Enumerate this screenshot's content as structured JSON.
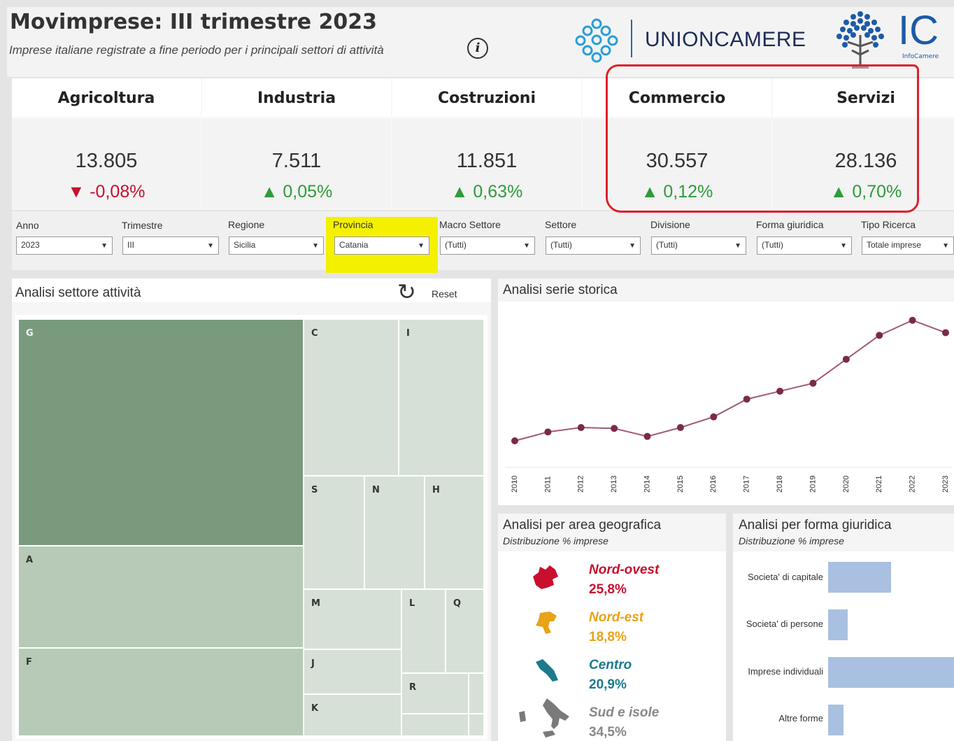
{
  "header": {
    "title": "Movimprese: III trimestre 2023",
    "subtitle": "Imprese italiane registrate a fine periodo per i principali settori di attività",
    "info_icon": "i",
    "logo_unioncamere": "UNIONCAMERE",
    "logo_ic": "IC",
    "logo_ic_sub": "InfoCamere"
  },
  "kpis": [
    {
      "name": "Agricoltura",
      "value": "13.805",
      "arrow": "▼",
      "delta": "-0,08%",
      "trend": "down"
    },
    {
      "name": "Industria",
      "value": "7.511",
      "arrow": "▲",
      "delta": "0,05%",
      "trend": "up"
    },
    {
      "name": "Costruzioni",
      "value": "11.851",
      "arrow": "▲",
      "delta": "0,63%",
      "trend": "up"
    },
    {
      "name": "Commercio",
      "value": "30.557",
      "arrow": "▲",
      "delta": "0,12%",
      "trend": "up"
    },
    {
      "name": "Servizi",
      "value": "28.136",
      "arrow": "▲",
      "delta": "0,70%",
      "trend": "up"
    }
  ],
  "filters": [
    {
      "label": "Anno",
      "value": "2023"
    },
    {
      "label": "Trimestre",
      "value": "III"
    },
    {
      "label": "Regione",
      "value": "Sicilia"
    },
    {
      "label": "Provincia",
      "value": "Catania"
    },
    {
      "label": "Macro Settore",
      "value": "(Tutti)"
    },
    {
      "label": "Settore",
      "value": "(Tutti)"
    },
    {
      "label": "Divisione",
      "value": "(Tutti)"
    },
    {
      "label": "Forma giuridica",
      "value": "(Tutti)"
    },
    {
      "label": "Tipo Ricerca",
      "value": "Totale imprese"
    }
  ],
  "treemap": {
    "title": "Analisi settore attività",
    "reset_label": "Reset",
    "tiles": [
      "G",
      "C",
      "I",
      "S",
      "N",
      "H",
      "A",
      "M",
      "L",
      "Q",
      "F",
      "J",
      "R",
      "K"
    ]
  },
  "timeseries": {
    "title": "Analisi serie storica"
  },
  "chart_data": {
    "type": "line",
    "title": "Analisi serie storica",
    "x": [
      "2010",
      "2011",
      "2012",
      "2013",
      "2014",
      "2015",
      "2016",
      "2017",
      "2018",
      "2019",
      "2020",
      "2021",
      "2022",
      "2023"
    ],
    "series": [
      {
        "values": [
          30,
          40,
          45,
          44,
          35,
          45,
          57,
          77,
          86,
          95,
          122,
          149,
          166,
          152
        ]
      }
    ],
    "xlabel": "",
    "ylabel": "",
    "grid": false,
    "color": "#7a2a4a"
  },
  "geo": {
    "title": "Analisi per area geografica",
    "subtitle": "Distribuzione % imprese",
    "areas": [
      {
        "name": "Nord-ovest",
        "pct": "25,8%",
        "color": "#c8102e"
      },
      {
        "name": "Nord-est",
        "pct": "18,8%",
        "color": "#e8a317"
      },
      {
        "name": "Centro",
        "pct": "20,9%",
        "color": "#1b7a8c"
      },
      {
        "name": "Sud e isole",
        "pct": "34,5%",
        "color": "#7a7a7a"
      }
    ]
  },
  "forma_giuridica": {
    "title": "Analisi per forma giuridica",
    "subtitle": "Distribuzione % imprese",
    "items": [
      {
        "label": "Societa' di capitale",
        "share": 0.45
      },
      {
        "label": "Societa' di persone",
        "share": 0.14
      },
      {
        "label": "Imprese individuali",
        "share": 0.9
      },
      {
        "label": "Altre forme",
        "share": 0.11
      }
    ],
    "bar_color": "#a9c0e0"
  }
}
